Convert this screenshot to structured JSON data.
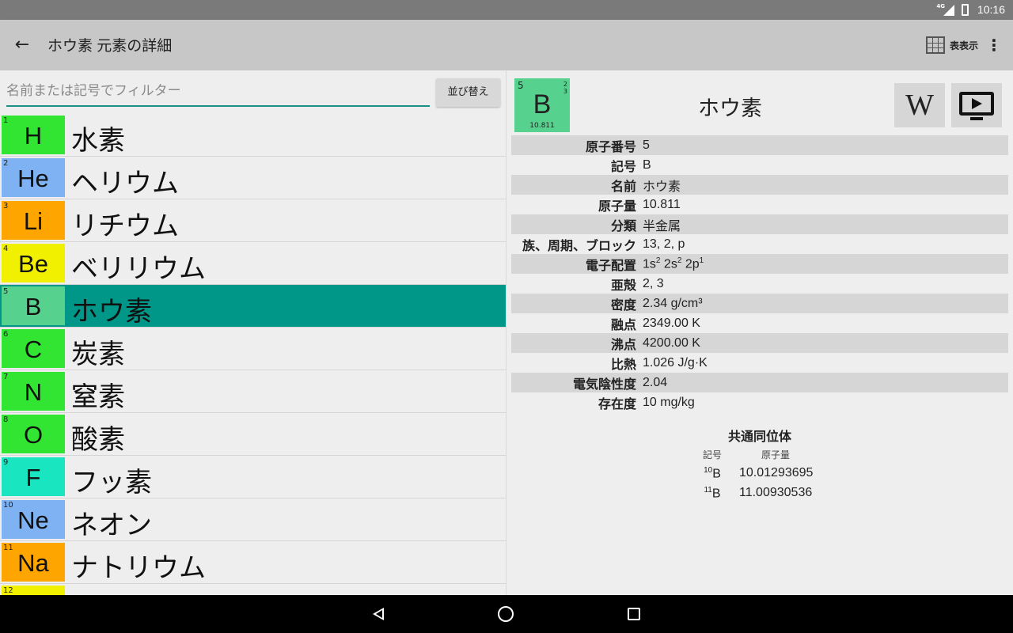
{
  "status": {
    "network": "4G",
    "time": "10:16"
  },
  "appbar": {
    "title": "ホウ素 元素の詳細",
    "table_label": "表表示"
  },
  "filter": {
    "placeholder": "名前または記号でフィルター",
    "value": "",
    "sort_label": "並び替え"
  },
  "elements": [
    {
      "num": "1",
      "sym": "H",
      "name": "水素",
      "color": "#33e533"
    },
    {
      "num": "2",
      "sym": "He",
      "name": "ヘリウム",
      "color": "#7fb2f2"
    },
    {
      "num": "3",
      "sym": "Li",
      "name": "リチウム",
      "color": "#ffa500"
    },
    {
      "num": "4",
      "sym": "Be",
      "name": "ベリリウム",
      "color": "#f0f000"
    },
    {
      "num": "5",
      "sym": "B",
      "name": "ホウ素",
      "color": "#57d18e",
      "selected": true
    },
    {
      "num": "6",
      "sym": "C",
      "name": "炭素",
      "color": "#33e533"
    },
    {
      "num": "7",
      "sym": "N",
      "name": "窒素",
      "color": "#33e533"
    },
    {
      "num": "8",
      "sym": "O",
      "name": "酸素",
      "color": "#33e533"
    },
    {
      "num": "9",
      "sym": "F",
      "name": "フッ素",
      "color": "#19e6c0"
    },
    {
      "num": "10",
      "sym": "Ne",
      "name": "ネオン",
      "color": "#7fb2f2"
    },
    {
      "num": "11",
      "sym": "Na",
      "name": "ナトリウム",
      "color": "#ffa500"
    },
    {
      "num": "12",
      "sym": "",
      "name": "",
      "color": "#f0f000"
    }
  ],
  "detail": {
    "tile": {
      "num": "5",
      "sym": "B",
      "mass": "10.811",
      "shell1": "2",
      "shell2": "3"
    },
    "title": "ホウ素",
    "properties": [
      {
        "k": "原子番号",
        "v": "5"
      },
      {
        "k": "記号",
        "v": "B"
      },
      {
        "k": "名前",
        "v": "ホウ素"
      },
      {
        "k": "原子量",
        "v": "10.811"
      },
      {
        "k": "分類",
        "v": "半金属"
      },
      {
        "k": "族、周期、ブロック",
        "v": "13, 2, p"
      },
      {
        "k": "電子配置",
        "v": "1s2 2s2 2p1"
      },
      {
        "k": "亜殻",
        "v": "2, 3"
      },
      {
        "k": "密度",
        "v": "2.34 g/cm³"
      },
      {
        "k": "融点",
        "v": "2349.00 K"
      },
      {
        "k": "沸点",
        "v": "4200.00 K"
      },
      {
        "k": "比熱",
        "v": "1.026 J/g·K"
      },
      {
        "k": "電気陰性度",
        "v": "2.04"
      },
      {
        "k": "存在度",
        "v": "10 mg/kg"
      }
    ],
    "isotopes": {
      "header": "共通同位体",
      "col_symbol": "記号",
      "col_mass": "原子量",
      "rows": [
        {
          "mass_number": "10",
          "sym": "B",
          "mass": "10.01293695"
        },
        {
          "mass_number": "11",
          "sym": "B",
          "mass": "11.00930536"
        }
      ]
    }
  }
}
